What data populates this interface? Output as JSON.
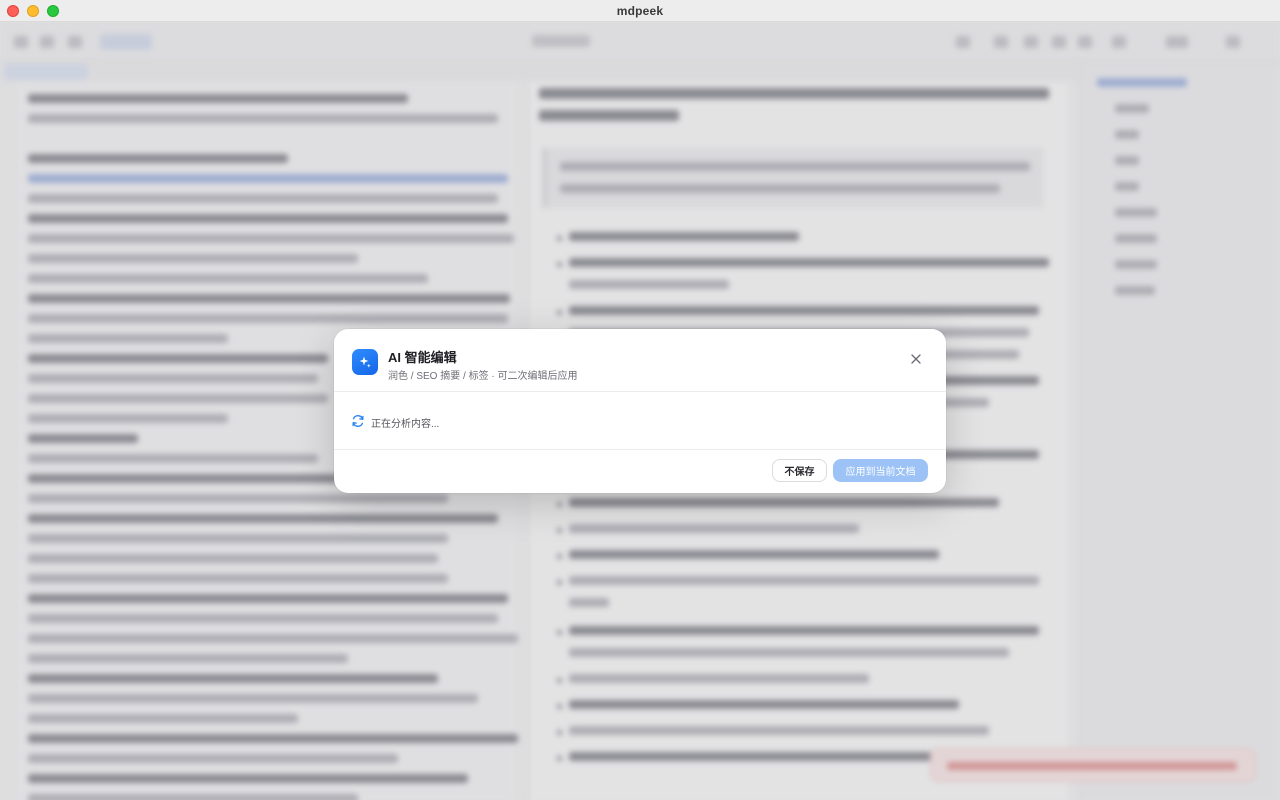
{
  "window": {
    "title": "mdpeek"
  },
  "dialog": {
    "title": "AI 智能编辑",
    "subtitle": "润色 / SEO 摘要 / 标签 · 可二次编辑后应用",
    "status_text": "正在分析内容...",
    "buttons": {
      "discard_label": "不保存",
      "apply_label": "应用到当前文档",
      "apply_disabled": true
    },
    "icons": {
      "badge": "ai-sparkle-icon",
      "close": "close-icon",
      "status": "refresh-spinner-icon"
    }
  },
  "colors": {
    "accent": "#1a73f0",
    "primary_button_disabled": "#9cc2f6",
    "toast_background": "#fbe9e9"
  }
}
